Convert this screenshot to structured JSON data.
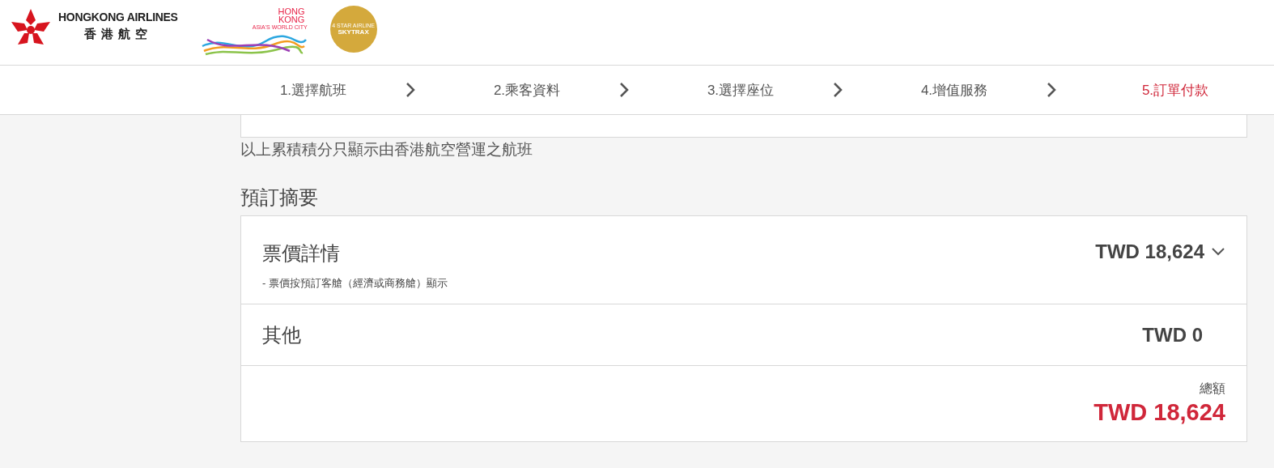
{
  "header": {
    "airline_name": "HONGKONG AIRLINES",
    "airline_name_zh": "香港航空",
    "city_logo": [
      "HONG",
      "KONG"
    ],
    "city_tagline": "ASIA'S WORLD CITY",
    "award_line": "4 STAR AIRLINE",
    "award_name": "SKYTRAX"
  },
  "steps": [
    {
      "label": "1.選擇航班",
      "selected": false
    },
    {
      "label": "2.乘客資料",
      "selected": false
    },
    {
      "label": "3.選擇座位",
      "selected": false
    },
    {
      "label": "4.增值服務",
      "selected": false
    },
    {
      "label": "5.訂單付款",
      "selected": true
    }
  ],
  "miles_note": "以上累積積分只顯示由香港航空營運之航班",
  "summary": {
    "title": "預訂摘要",
    "rows": [
      {
        "kind": "fare",
        "label": "票價詳情",
        "note": "- 票價按預訂客艙（經濟或商務艙）顯示",
        "amount": "TWD 18,624"
      },
      {
        "kind": "other",
        "label": "其他",
        "amount": "TWD 0"
      },
      {
        "kind": "total",
        "label": "總額",
        "amount": "TWD 18,624"
      }
    ]
  }
}
